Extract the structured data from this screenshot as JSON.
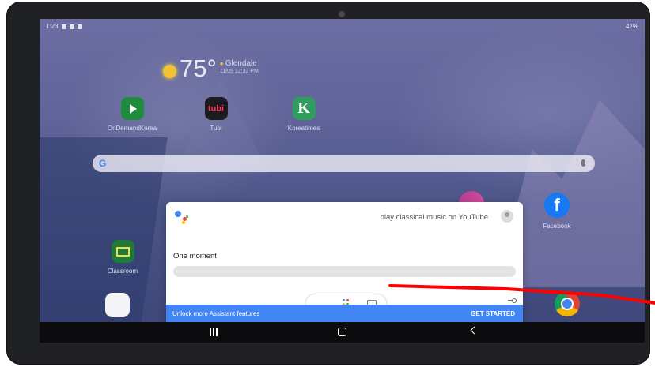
{
  "status_bar": {
    "time": "1:23",
    "battery": "42%"
  },
  "weather": {
    "temperature": "75°",
    "location": "Glendale",
    "updated": "11/05 12:33 PM"
  },
  "apps": [
    {
      "label": "OnDemandKorea",
      "icon": "ondemandkorea-icon"
    },
    {
      "label": "Tubi",
      "icon": "tubi-icon",
      "icon_text": "tubi"
    },
    {
      "label": "Koreatimes",
      "icon": "koreatimes-icon",
      "icon_text": "K"
    }
  ],
  "dock_apps": {
    "classroom": "Classroom",
    "facebook": "Facebook"
  },
  "search_bar": {
    "logo": "G"
  },
  "assistant": {
    "query": "play classical music on YouTube",
    "status": "One moment",
    "unlock_text": "Unlock more Assistant features",
    "cta": "GET STARTED"
  },
  "colors": {
    "assistant_blue": "#4285f4",
    "overlay_line": "#ff0000"
  }
}
